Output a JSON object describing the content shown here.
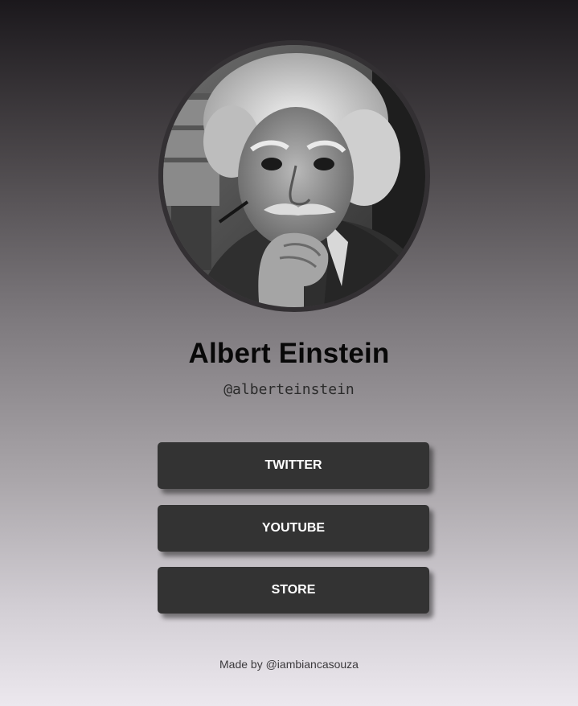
{
  "profile": {
    "avatar_icon": "profile-photo",
    "name": "Albert Einstein",
    "handle": "@alberteinstein"
  },
  "links": [
    {
      "label": "TWITTER"
    },
    {
      "label": "YOUTUBE"
    },
    {
      "label": "STORE"
    }
  ],
  "footer": {
    "text": "Made by @iambiancasouza"
  },
  "colors": {
    "button_bg": "#333333",
    "button_text": "#ffffff",
    "name_text": "#080808",
    "gradient_top": "#1b181c",
    "gradient_bottom": "#ece8ee"
  }
}
